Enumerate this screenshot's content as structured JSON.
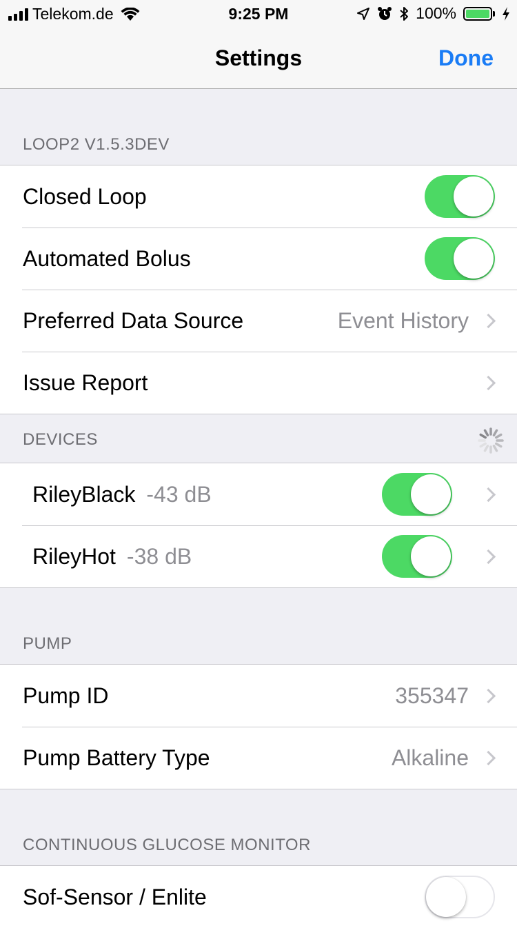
{
  "status_bar": {
    "carrier": "Telekom.de",
    "time": "9:25 PM",
    "battery_percent": "100%"
  },
  "nav": {
    "title": "Settings",
    "done_label": "Done"
  },
  "sections": {
    "loop": {
      "header": "LOOP2 V1.5.3DEV",
      "closed_loop_label": "Closed Loop",
      "closed_loop_on": true,
      "automated_bolus_label": "Automated Bolus",
      "automated_bolus_on": true,
      "data_source_label": "Preferred Data Source",
      "data_source_value": "Event History",
      "issue_report_label": "Issue Report"
    },
    "devices": {
      "header": "DEVICES",
      "items": [
        {
          "name": "RileyBlack",
          "rssi": "-43 dB",
          "enabled": true
        },
        {
          "name": "RileyHot",
          "rssi": "-38 dB",
          "enabled": true
        }
      ]
    },
    "pump": {
      "header": "PUMP",
      "pump_id_label": "Pump ID",
      "pump_id_value": "355347",
      "battery_type_label": "Pump Battery Type",
      "battery_type_value": "Alkaline"
    },
    "cgm": {
      "header": "CONTINUOUS GLUCOSE MONITOR",
      "sof_sensor_label": "Sof-Sensor / Enlite",
      "sof_sensor_on": false
    }
  },
  "colors": {
    "accent": "#1a7cf5",
    "toggle_on": "#4cd964",
    "background": "#efeff4",
    "secondary_text": "#8e8e93"
  }
}
